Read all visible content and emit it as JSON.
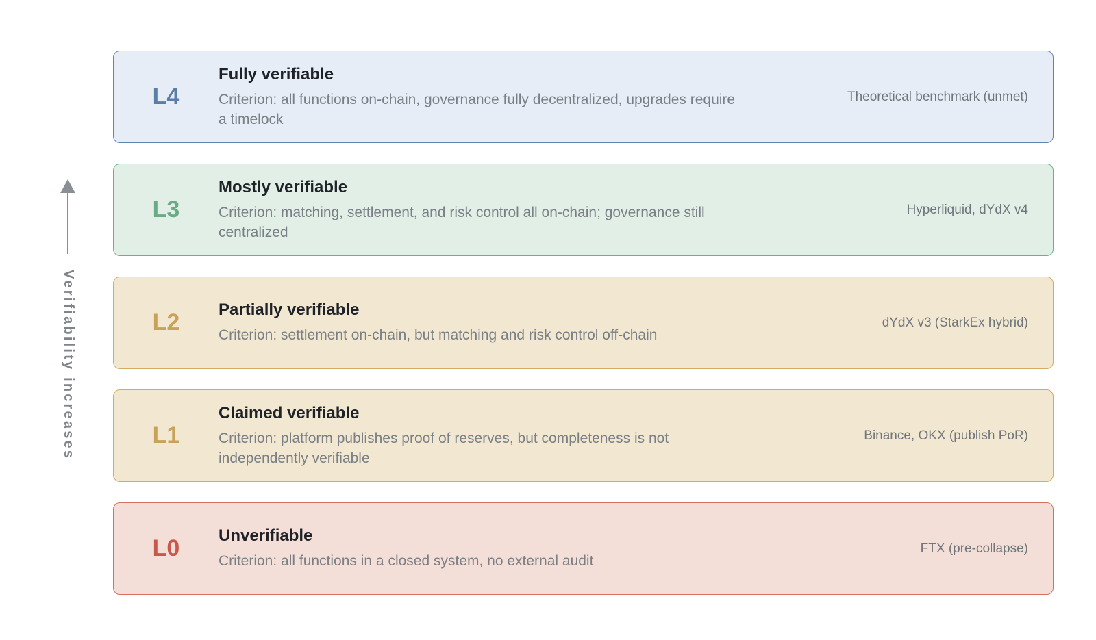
{
  "axis": {
    "label": "Verifiability increases"
  },
  "levels": [
    {
      "code": "L4",
      "title": "Fully verifiable",
      "criterion": "Criterion: all functions on-chain, governance fully decentralized, upgrades require a timelock",
      "example": "Theoretical benchmark (unmet)",
      "colors": {
        "bg": "#e6edf6",
        "border": "#5f84ad",
        "code": "#5a7ea6"
      }
    },
    {
      "code": "L3",
      "title": "Mostly verifiable",
      "criterion": "Criterion: matching, settlement, and risk control all on-chain; governance still centralized",
      "example": "Hyperliquid, dYdX v4",
      "colors": {
        "bg": "#e2efe7",
        "border": "#6fae8d",
        "code": "#6aaa86"
      }
    },
    {
      "code": "L2",
      "title": "Partially verifiable",
      "criterion": "Criterion: settlement on-chain, but matching and risk control off-chain",
      "example": "dYdX v3 (StarkEx hybrid)",
      "colors": {
        "bg": "#f2e7d1",
        "border": "#d4ab62",
        "code": "#c9a25a"
      }
    },
    {
      "code": "L1",
      "title": "Claimed verifiable",
      "criterion": "Criterion: platform publishes proof of reserves, but completeness is not independently verifiable",
      "example": "Binance, OKX (publish PoR)",
      "colors": {
        "bg": "#f2e7d1",
        "border": "#d4ab62",
        "code": "#c9a25a"
      }
    },
    {
      "code": "L0",
      "title": "Unverifiable",
      "criterion": "Criterion: all functions in a closed system, no external audit",
      "example": "FTX (pre-collapse)",
      "colors": {
        "bg": "#f4ded8",
        "border": "#d96f62",
        "code": "#c8584c"
      }
    }
  ]
}
